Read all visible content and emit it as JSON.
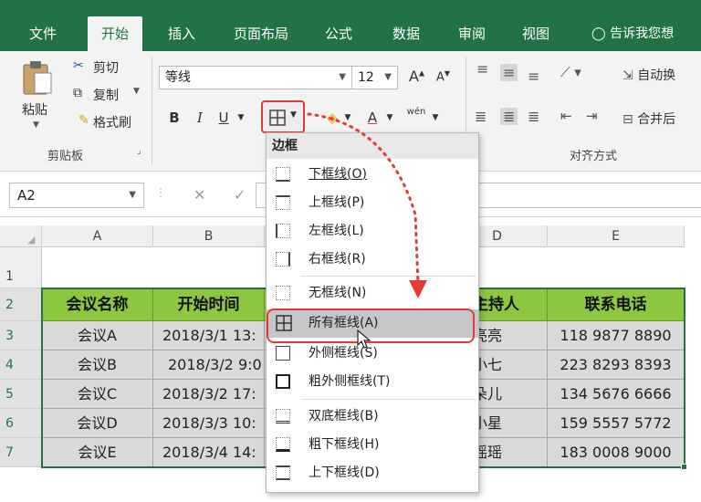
{
  "tabs": [
    {
      "label": "文件",
      "active": false
    },
    {
      "label": "开始",
      "active": true
    },
    {
      "label": "插入",
      "active": false
    },
    {
      "label": "页面布局",
      "active": false
    },
    {
      "label": "公式",
      "active": false
    },
    {
      "label": "数据",
      "active": false
    },
    {
      "label": "审阅",
      "active": false
    },
    {
      "label": "视图",
      "active": false
    }
  ],
  "tell_me": "告诉我您想",
  "ribbon": {
    "paste_label": "粘贴",
    "cut_label": "剪切",
    "copy_label": "复制",
    "format_painter_label": "格式刷",
    "clipboard_group": "剪贴板",
    "font_name": "等线",
    "font_size": "12",
    "bold": "B",
    "italic": "I",
    "underline": "U",
    "font_color": "A",
    "phonetic": "wén",
    "align_group": "对齐方式",
    "wrap_text": "自动换",
    "merge_center": "合并后"
  },
  "formula_bar": {
    "cell_ref": "A2"
  },
  "columns": [
    "A",
    "B",
    "C",
    "D",
    "E"
  ],
  "rows": [
    "1",
    "2",
    "3",
    "4",
    "5",
    "6",
    "7"
  ],
  "table": {
    "headers": [
      "会议名称",
      "开始时间",
      "主持人",
      "联系电话"
    ],
    "rows": [
      [
        "会议A",
        "2018/3/1 13:",
        "亮亮",
        "118 9877 8890"
      ],
      [
        "会议B",
        "2018/3/2 9:0",
        "小七",
        "223 8293 8393"
      ],
      [
        "会议C",
        "2018/3/2 17:",
        "朵儿",
        "134 5676 6666"
      ],
      [
        "会议D",
        "2018/3/3 10:",
        "小星",
        "159 5557 5772"
      ],
      [
        "会议E",
        "2018/3/4 14:",
        "瑶瑶",
        "183 0008 9000"
      ]
    ]
  },
  "border_menu": {
    "title": "边框",
    "items": [
      {
        "label": "下框线(O)",
        "highlighted": false
      },
      {
        "label": "上框线(P)",
        "highlighted": false
      },
      {
        "label": "左框线(L)",
        "highlighted": false
      },
      {
        "label": "右框线(R)",
        "highlighted": false
      },
      {
        "label": "无框线(N)",
        "highlighted": false
      },
      {
        "label": "所有框线(A)",
        "highlighted": true
      },
      {
        "label": "外侧框线(S)",
        "highlighted": false
      },
      {
        "label": "粗外侧框线(T)",
        "highlighted": false
      },
      {
        "label": "双底框线(B)",
        "highlighted": false
      },
      {
        "label": "粗下框线(H)",
        "highlighted": false
      },
      {
        "label": "上下框线(D)",
        "highlighted": false
      }
    ]
  },
  "colors": {
    "brand_green": "#217346",
    "header_green": "#8dc63f",
    "data_gray": "#d9d9d9",
    "annotation_red": "#e53935"
  }
}
